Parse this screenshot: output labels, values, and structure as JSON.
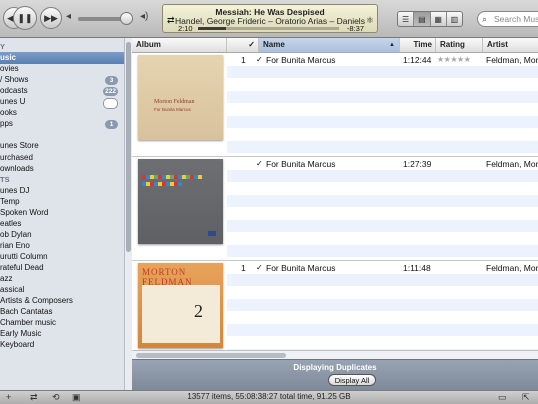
{
  "toolbar": {
    "prev_icon": "rewind-icon",
    "pause_icon": "pause-icon",
    "next_icon": "fast-forward-icon",
    "lcd": {
      "title": "Messiah: He Was Despised",
      "subtitle": "Handel, George Frideric – Oratorio Arias – Daniels",
      "elapsed": "2:10",
      "remaining": "-8:37",
      "progress": 0.2
    },
    "search_placeholder": "Search Music"
  },
  "sidebar": {
    "items": [
      {
        "label": "Y",
        "type": "head"
      },
      {
        "label": "usic",
        "type": "item",
        "selected": true
      },
      {
        "label": "ovies",
        "type": "item"
      },
      {
        "label": "/ Shows",
        "type": "item",
        "badge": "3"
      },
      {
        "label": "odcasts",
        "type": "item",
        "badge": "222"
      },
      {
        "label": "unes U",
        "type": "item",
        "badge": " ",
        "hollow": true
      },
      {
        "label": "ooks",
        "type": "item"
      },
      {
        "label": "pps",
        "type": "item",
        "badge": "1"
      },
      {
        "label": "",
        "type": "gap"
      },
      {
        "label": "unes Store",
        "type": "item"
      },
      {
        "label": "urchased",
        "type": "item"
      },
      {
        "label": "ownloads",
        "type": "item"
      },
      {
        "label": "TS",
        "type": "head"
      },
      {
        "label": "unes DJ",
        "type": "item"
      },
      {
        "label": "Temp",
        "type": "item"
      },
      {
        "label": "Spoken Word",
        "type": "item"
      },
      {
        "label": "eatles",
        "type": "item"
      },
      {
        "label": "ob Dylan",
        "type": "item"
      },
      {
        "label": "rian Eno",
        "type": "item"
      },
      {
        "label": "urutti Column",
        "type": "item"
      },
      {
        "label": "rateful Dead",
        "type": "item"
      },
      {
        "label": "azz",
        "type": "item"
      },
      {
        "label": "assical",
        "type": "item"
      },
      {
        "label": "Artists & Composers",
        "type": "item"
      },
      {
        "label": "Bach Cantatas",
        "type": "item"
      },
      {
        "label": "Chamber music",
        "type": "item"
      },
      {
        "label": "Early Music",
        "type": "item"
      },
      {
        "label": "Keyboard",
        "type": "item"
      }
    ]
  },
  "columns": {
    "album": "Album",
    "check": "✓",
    "name": "Name",
    "time": "Time",
    "rating": "Rating",
    "artist": "Artist"
  },
  "tracks": [
    {
      "num": "1",
      "check": "✓",
      "name": "For Bunita Marcus",
      "time": "1:12:44",
      "rating": "★★★★★",
      "artist": "Feldman, Mor"
    },
    {
      "num": "",
      "check": "✓",
      "name": "For Bunita Marcus",
      "time": "1:27:39",
      "rating": "",
      "artist": "Feldman, Mor"
    },
    {
      "num": "1",
      "check": "✓",
      "name": "For Bunita Marcus",
      "time": "1:11:48",
      "rating": "",
      "artist": "Feldman, Mor"
    }
  ],
  "album_art": [
    {
      "line1": "Morton Feldman",
      "line2": "For Bunita Marcus"
    },
    {
      "line1": "",
      "line2": ""
    },
    {
      "line1": "MORTON FELDMAN",
      "line2": "2"
    }
  ],
  "duplicates": {
    "label": "Displaying Duplicates",
    "button": "Display All"
  },
  "status": {
    "summary": "13577 items, 55:08:38:27 total time, 91.25 GB"
  }
}
